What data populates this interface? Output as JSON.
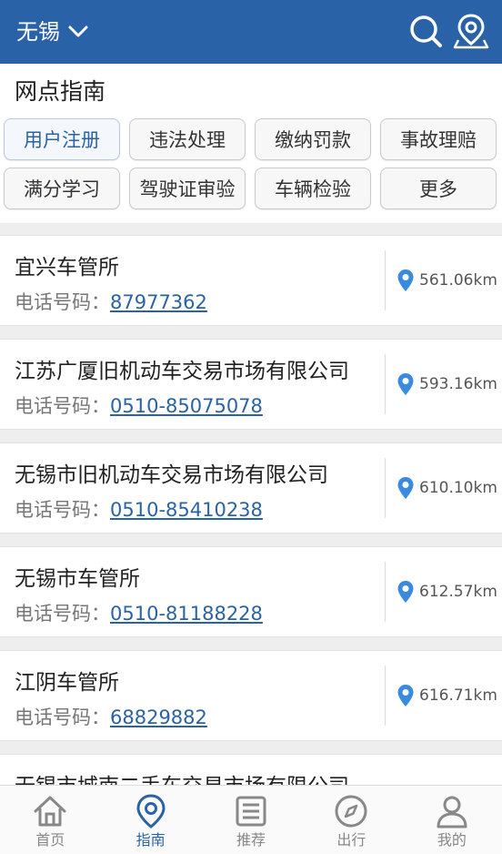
{
  "header": {
    "city": "无锡",
    "icons": [
      "chevron-down-icon",
      "search-icon",
      "map-pin-icon"
    ],
    "background_color": "#2a62a8"
  },
  "guide": {
    "title": "网点指南",
    "categories": [
      {
        "label": "用户注册",
        "active": true
      },
      {
        "label": "违法处理",
        "active": false
      },
      {
        "label": "缴纳罚款",
        "active": false
      },
      {
        "label": "事故理赔",
        "active": false
      },
      {
        "label": "满分学习",
        "active": false
      },
      {
        "label": "驾驶证审验",
        "active": false
      },
      {
        "label": "车辆检验",
        "active": false
      },
      {
        "label": "更多",
        "active": false
      }
    ]
  },
  "phone_label": "电话号码：",
  "offices": [
    {
      "name": "宜兴车管所",
      "phone": "87977362",
      "distance": "561.06km"
    },
    {
      "name": "江苏广厦旧机动车交易市场有限公司",
      "phone": "0510-85075078",
      "distance": "593.16km"
    },
    {
      "name": "无锡市旧机动车交易市场有限公司",
      "phone": "0510-85410238",
      "distance": "610.10km"
    },
    {
      "name": "无锡市车管所",
      "phone": "0510-81188228",
      "distance": "612.57km"
    },
    {
      "name": "江阴车管所",
      "phone": "68829882",
      "distance": "616.71km"
    },
    {
      "name": "无锡市城南二手车交易市场有限公司",
      "phone": "",
      "distance": ""
    }
  ],
  "tabbar": {
    "tabs": [
      {
        "label": "首页",
        "icon": "home-icon",
        "active": false
      },
      {
        "label": "指南",
        "icon": "location-pin-icon",
        "active": true
      },
      {
        "label": "推荐",
        "icon": "list-icon",
        "active": false
      },
      {
        "label": "出行",
        "icon": "compass-icon",
        "active": false
      },
      {
        "label": "我的",
        "icon": "user-icon",
        "active": false
      }
    ]
  },
  "colors": {
    "accent": "#2a62a8",
    "pin": "#3a8be0"
  }
}
